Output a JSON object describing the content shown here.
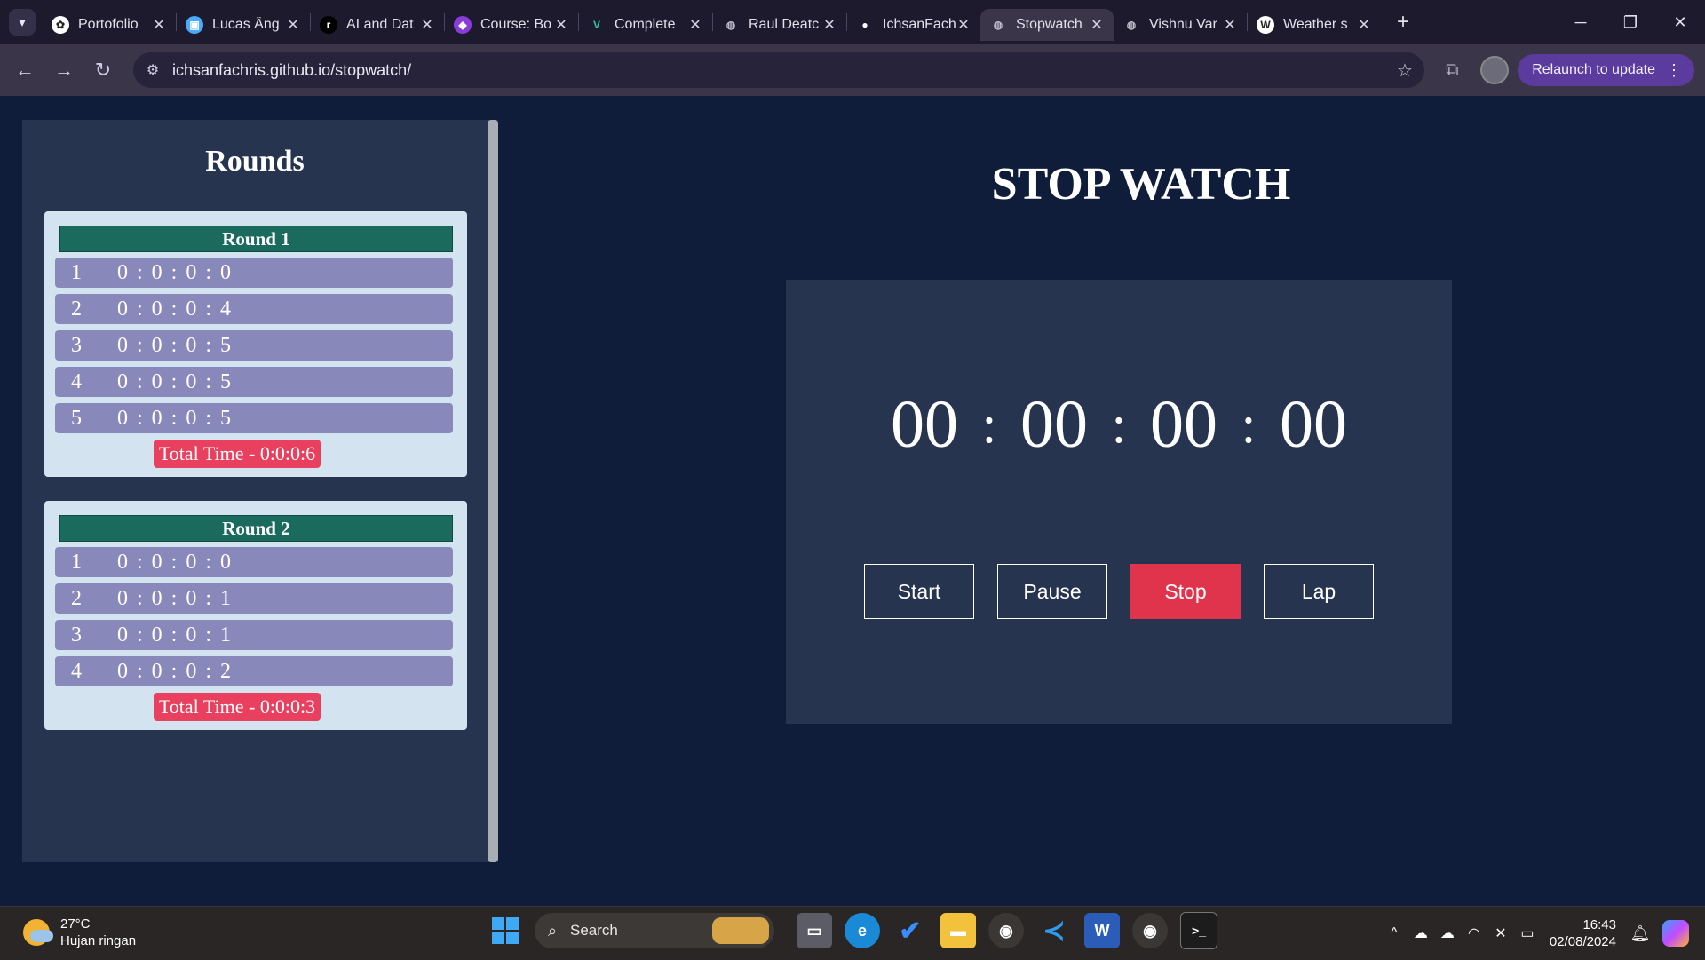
{
  "browser": {
    "tabs": [
      {
        "title": "Portofolio",
        "favicon": "openai-icon",
        "active": false
      },
      {
        "title": "Lucas Âng",
        "favicon": "app-icon",
        "active": false
      },
      {
        "title": "AI and Dat",
        "favicon": "r-icon",
        "active": false
      },
      {
        "title": "Course: Bo",
        "favicon": "course-icon",
        "active": false
      },
      {
        "title": "Complete",
        "favicon": "v-icon",
        "active": false
      },
      {
        "title": "Raul Deatc",
        "favicon": "globe-icon",
        "active": false
      },
      {
        "title": "IchsanFach",
        "favicon": "github-icon",
        "active": false
      },
      {
        "title": "Stopwatch",
        "favicon": "globe-icon",
        "active": true
      },
      {
        "title": "Vishnu Var",
        "favicon": "globe-icon",
        "active": false
      },
      {
        "title": "Weather s",
        "favicon": "w-icon",
        "active": false
      }
    ],
    "url": "ichsanfachris.github.io/stopwatch/",
    "relaunch_label": "Relaunch to update"
  },
  "rounds_panel": {
    "title": "Rounds",
    "rounds": [
      {
        "label": "Round 1",
        "laps": [
          {
            "num": "1",
            "time": "0 : 0 : 0 : 0"
          },
          {
            "num": "2",
            "time": "0 : 0 : 0 : 4"
          },
          {
            "num": "3",
            "time": "0 : 0 : 0 : 5"
          },
          {
            "num": "4",
            "time": "0 : 0 : 0 : 5"
          },
          {
            "num": "5",
            "time": "0 : 0 : 0 : 5"
          }
        ],
        "total": "Total Time - 0:0:0:6"
      },
      {
        "label": "Round 2",
        "laps": [
          {
            "num": "1",
            "time": "0 : 0 : 0 : 0"
          },
          {
            "num": "2",
            "time": "0 : 0 : 0 : 1"
          },
          {
            "num": "3",
            "time": "0 : 0 : 0 : 1"
          },
          {
            "num": "4",
            "time": "0 : 0 : 0 : 2"
          }
        ],
        "total": "Total Time - 0:0:0:3"
      }
    ]
  },
  "stopwatch": {
    "title": "STOP WATCH",
    "display": {
      "h": "00",
      "m": "00",
      "s": "00",
      "ms": "00",
      "separator": ":"
    },
    "buttons": {
      "start": "Start",
      "pause": "Pause",
      "stop": "Stop",
      "lap": "Lap"
    }
  },
  "taskbar": {
    "weather_temp": "27°C",
    "weather_desc": "Hujan ringan",
    "search_label": "Search",
    "time": "16:43",
    "date": "02/08/2024"
  },
  "colors": {
    "page_bg": "#0f1c3a",
    "panel_bg": "#27344f",
    "round_header": "#1a6a5e",
    "lap_row": "#8988ba",
    "total_badge": "#e8405e",
    "stop_button": "#e0344c"
  }
}
